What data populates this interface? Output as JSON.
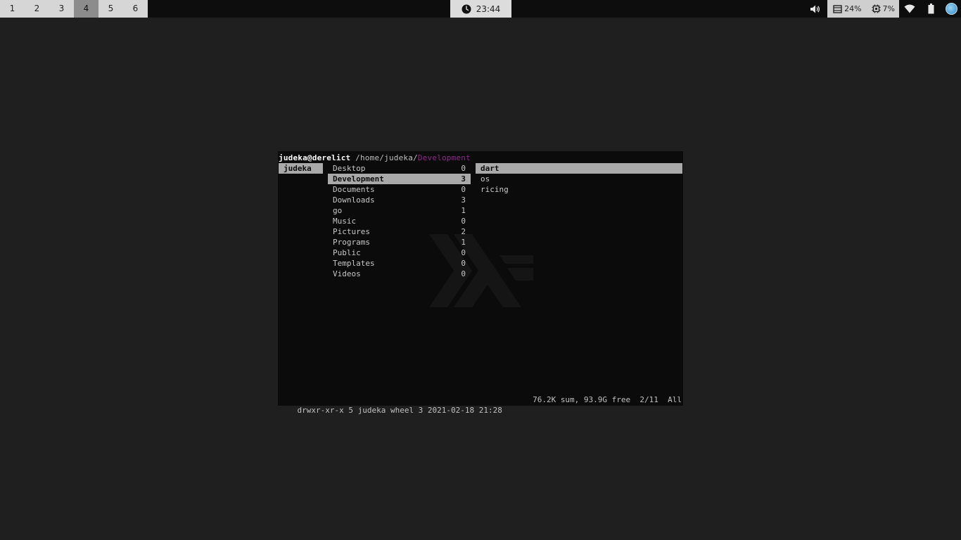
{
  "topbar": {
    "workspaces": [
      "1",
      "2",
      "3",
      "4",
      "5",
      "6"
    ],
    "active_workspace": "4",
    "clock": "23:44",
    "memory": "24%",
    "cpu": "7%",
    "icons": [
      "volume-icon",
      "memory-icon",
      "cpu-icon",
      "wifi-icon",
      "battery-icon",
      "avatar-icon"
    ]
  },
  "terminal": {
    "user_host": "judeka@derelict",
    "path_prefix": " /home/judeka/",
    "path_current": "Development",
    "parent_dir": "judeka",
    "dirs": [
      {
        "name": "Desktop",
        "count": "0"
      },
      {
        "name": "Development",
        "count": "3"
      },
      {
        "name": "Documents",
        "count": "0"
      },
      {
        "name": "Downloads",
        "count": "3"
      },
      {
        "name": "go",
        "count": "1"
      },
      {
        "name": "Music",
        "count": "0"
      },
      {
        "name": "Pictures",
        "count": "2"
      },
      {
        "name": "Programs",
        "count": "1"
      },
      {
        "name": "Public",
        "count": "0"
      },
      {
        "name": "Templates",
        "count": "0"
      },
      {
        "name": "Videos",
        "count": "0"
      }
    ],
    "selected_dir_index": 1,
    "preview": [
      "dart",
      "os",
      "ricing"
    ],
    "status": {
      "info": "drwxr-xr-x 5 judeka wheel 3 2021-02-18 21:28",
      "summary": "76.2K sum, 93.9G free  2/11  All"
    }
  }
}
